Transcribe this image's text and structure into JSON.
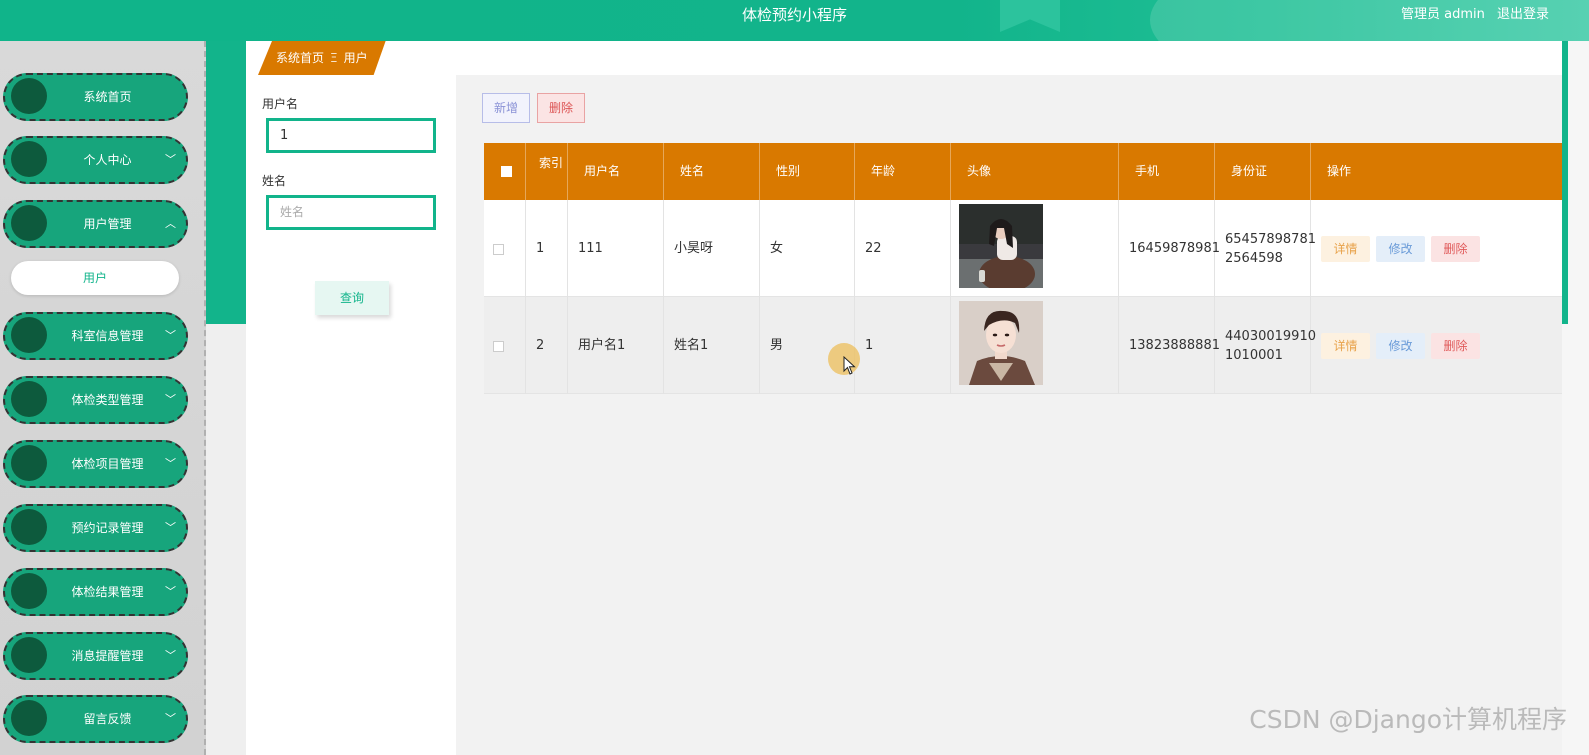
{
  "header": {
    "title": "体检预约小程序",
    "admin_label": "管理员 admin",
    "logout_label": "退出登录"
  },
  "sidebar": {
    "items": [
      {
        "label": "系统首页",
        "has_chevron": false,
        "chevron": ""
      },
      {
        "label": "个人中心",
        "has_chevron": true,
        "chevron": "﹀"
      },
      {
        "label": "用户管理",
        "has_chevron": true,
        "chevron": "︿",
        "expanded": true
      },
      {
        "label": "科室信息管理",
        "has_chevron": true,
        "chevron": "﹀"
      },
      {
        "label": "体检类型管理",
        "has_chevron": true,
        "chevron": "﹀"
      },
      {
        "label": "体检项目管理",
        "has_chevron": true,
        "chevron": "﹀"
      },
      {
        "label": "预约记录管理",
        "has_chevron": true,
        "chevron": "﹀"
      },
      {
        "label": "体检结果管理",
        "has_chevron": true,
        "chevron": "﹀"
      },
      {
        "label": "消息提醒管理",
        "has_chevron": true,
        "chevron": "﹀"
      },
      {
        "label": "留言反馈",
        "has_chevron": true,
        "chevron": "﹀"
      }
    ],
    "sub_item": "用户"
  },
  "breadcrumb": {
    "home": "系统首页",
    "sep": "Ξ",
    "current": "用户"
  },
  "search": {
    "username_label": "用户名",
    "username_value": "1",
    "name_label": "姓名",
    "name_placeholder": "姓名",
    "query_label": "查询"
  },
  "toolbar": {
    "add_label": "新增",
    "delete_label": "删除"
  },
  "table": {
    "headers": {
      "index": "索引",
      "username": "用户名",
      "name": "姓名",
      "gender": "性别",
      "age": "年龄",
      "avatar": "头像",
      "phone": "手机",
      "idcard": "身份证",
      "ops": "操作"
    },
    "rows": [
      {
        "index": "1",
        "username": "111",
        "name": "小昊呀",
        "gender": "女",
        "age": "22",
        "phone": "16459878981",
        "idcard_line1": "65457898781",
        "idcard_line2": "2564598"
      },
      {
        "index": "2",
        "username": "用户名1",
        "name": "姓名1",
        "gender": "男",
        "age": "1",
        "phone": "13823888881",
        "idcard_line1": "44030019910",
        "idcard_line2": "1010001"
      }
    ],
    "ops": {
      "detail": "详情",
      "edit": "修改",
      "delete": "删除"
    }
  },
  "watermark": "CSDN @Django计算机程序",
  "colors": {
    "primary_green": "#12b48b",
    "header_orange": "#d97900",
    "nav_green": "#17a57c"
  }
}
